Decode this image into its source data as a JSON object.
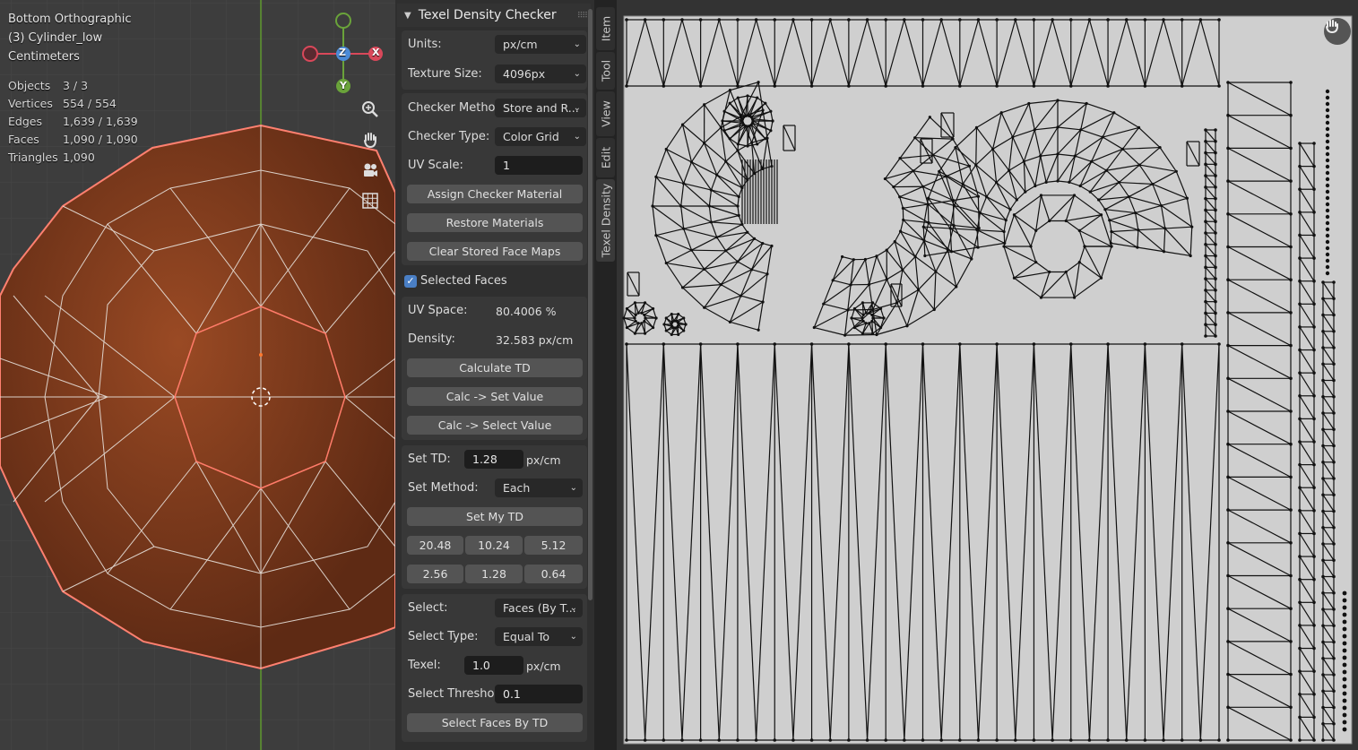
{
  "viewport": {
    "view_name": "Bottom Orthographic",
    "object_name": "(3) Cylinder_low",
    "units": "Centimeters",
    "stats": [
      {
        "label": "Objects",
        "value": "3 / 3"
      },
      {
        "label": "Vertices",
        "value": "554 / 554"
      },
      {
        "label": "Edges",
        "value": "1,639 / 1,639"
      },
      {
        "label": "Faces",
        "value": "1,090 / 1,090"
      },
      {
        "label": "Triangles",
        "value": "1,090"
      }
    ],
    "gizmo": {
      "z": "Z",
      "y": "Y",
      "x": "X"
    },
    "nav_icons": [
      "zoom-icon",
      "hand-pan-icon",
      "camera-icon",
      "grid-icon"
    ]
  },
  "panel": {
    "title": "Texel Density Checker",
    "units_label": "Units:",
    "units_value": "px/cm",
    "texture_size_label": "Texture Size:",
    "texture_size_value": "4096px",
    "checker_method_label": "Checker Method:",
    "checker_method_value": "Store and R...",
    "checker_type_label": "Checker Type:",
    "checker_type_value": "Color Grid",
    "uv_scale_label": "UV Scale:",
    "uv_scale_value": "1",
    "assign_checker": "Assign Checker Material",
    "restore_materials": "Restore Materials",
    "clear_maps": "Clear Stored Face Maps",
    "selected_faces": "Selected Faces",
    "uv_space_label": "UV Space:",
    "uv_space_value": "80.4006 %",
    "density_label": "Density:",
    "density_value": "32.583 px/cm",
    "calculate_td": "Calculate TD",
    "calc_set_value": "Calc -> Set Value",
    "calc_select_value": "Calc -> Select Value",
    "set_td_label": "Set TD:",
    "set_td_value": "1.28",
    "set_td_unit": "px/cm",
    "set_method_label": "Set Method:",
    "set_method_value": "Each",
    "set_my_td": "Set My TD",
    "presets": [
      "20.48",
      "10.24",
      "5.12",
      "2.56",
      "1.28",
      "0.64"
    ],
    "select_label": "Select:",
    "select_value": "Faces (By T...",
    "select_type_label": "Select Type:",
    "select_type_value": "Equal To",
    "texel_label": "Texel:",
    "texel_value": "1.0",
    "texel_unit": "px/cm",
    "select_threshold_label": "Select Threshold:",
    "select_threshold_value": "0.1",
    "select_faces_btn": "Select Faces By TD"
  },
  "tabs": [
    "Item",
    "Tool",
    "View",
    "Edit",
    "Texel Density"
  ],
  "colors": {
    "accent": "#4a7fc5",
    "mesh": "#8a3d1c",
    "wire": "#ff6a55",
    "grid_axis": "#5a9a2a"
  }
}
